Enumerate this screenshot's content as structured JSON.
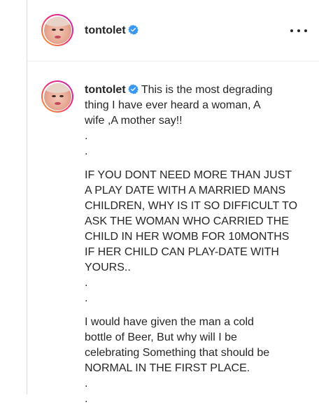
{
  "header": {
    "username": "tontolet",
    "verified": true,
    "more_label": "•••"
  },
  "caption": {
    "username": "tontolet",
    "first_line": "This is the most degrading",
    "lines_block1": [
      "thing I have ever heard a woman, A",
      "wife ,A mother say!!",
      ".",
      "."
    ],
    "lines_block2": [
      "IF YOU DONT NEED MORE THAN JUST",
      "A PLAY DATE WITH A MARRIED MANS",
      "CHILDREN, WHY IS IT SO DIFFICULT TO",
      "ASK THE WOMAN WHO CARRIED THE",
      "CHILD IN HER WOMB FOR 10MONTHS",
      "IF HER CHILD CAN PLAY-DATE WITH",
      "YOURS..",
      ".",
      "."
    ],
    "lines_block3": [
      "I would have given the man a cold",
      "bottle of Beer, But why will I be",
      "celebrating Something that should be",
      "NORMAL IN THE FIRST PLACE.",
      ".",
      "."
    ]
  },
  "colors": {
    "verified_badge": "#3897f0",
    "text": "#262626",
    "border": "#dbdbdb"
  }
}
